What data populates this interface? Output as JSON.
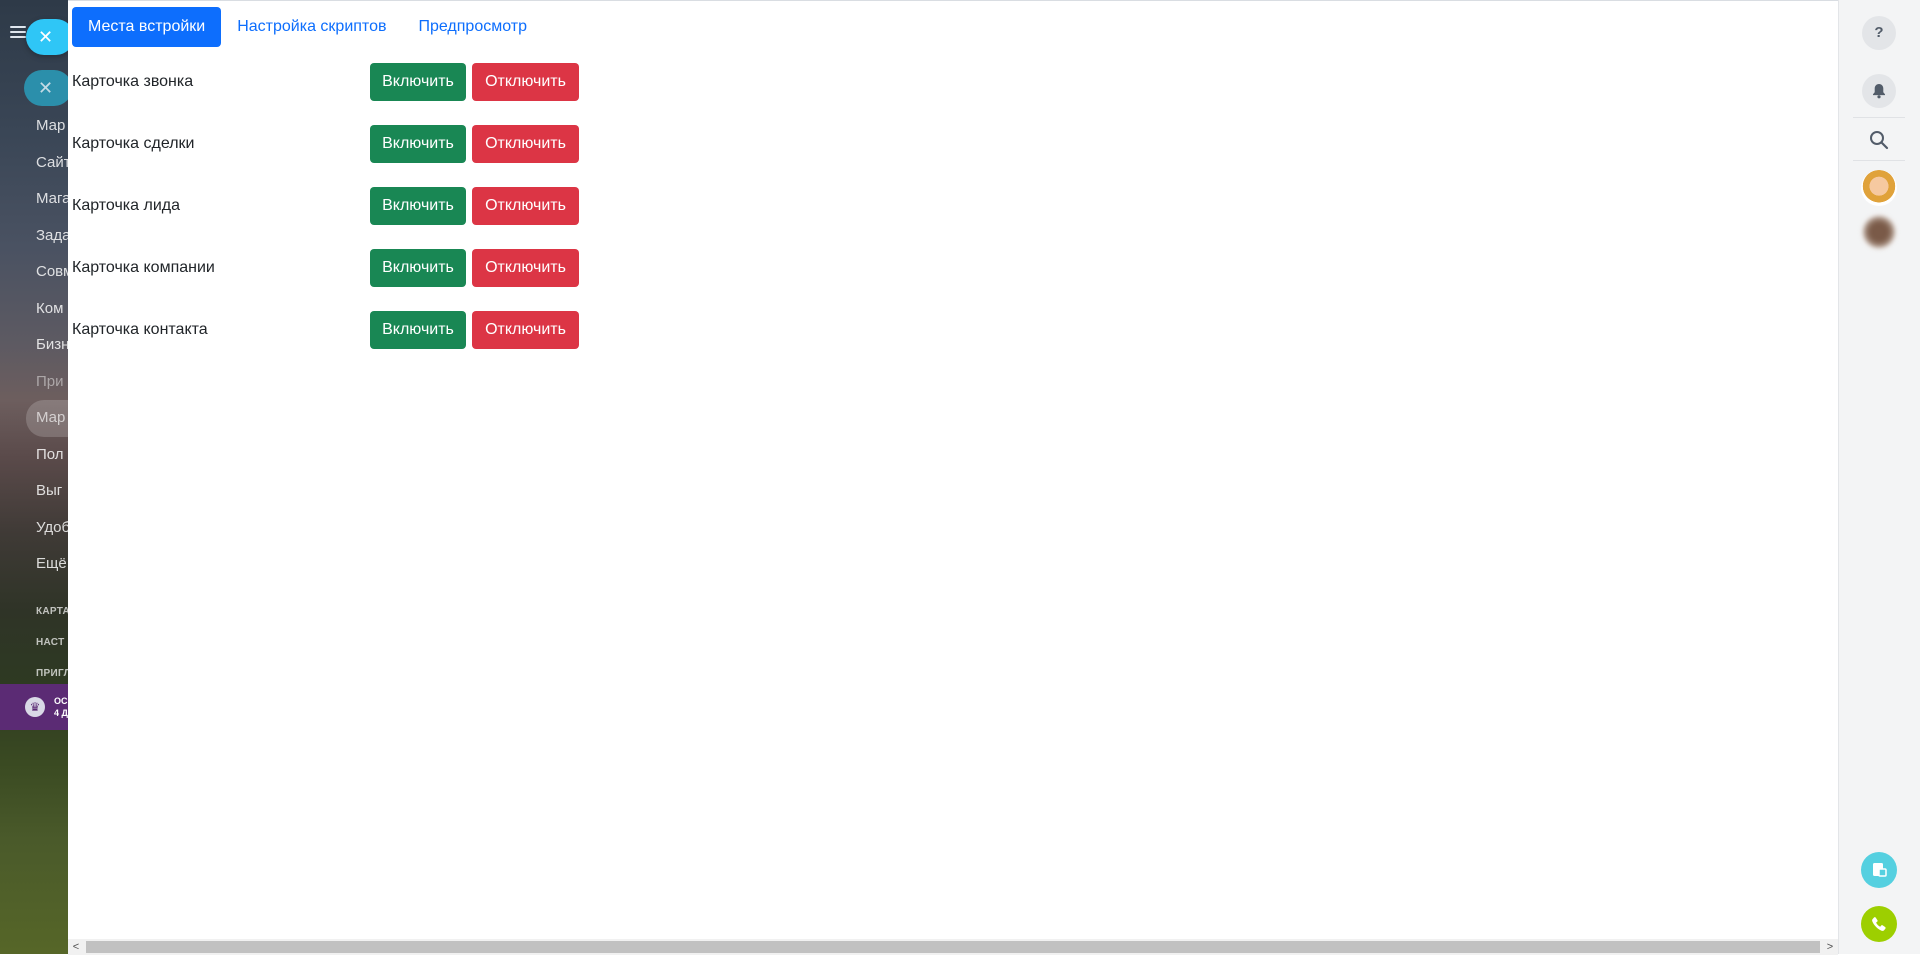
{
  "tabs": [
    {
      "label": "Места встройки",
      "active": true
    },
    {
      "label": "Настройка скриптов",
      "active": false
    },
    {
      "label": "Предпросмотр",
      "active": false
    }
  ],
  "placements": [
    {
      "label": "Карточка звонка"
    },
    {
      "label": "Карточка сделки"
    },
    {
      "label": "Карточка лида"
    },
    {
      "label": "Карточка компании"
    },
    {
      "label": "Карточка контакта"
    }
  ],
  "buttons": {
    "enable": "Включить",
    "disable": "Отключить"
  },
  "sidebar": {
    "items": [
      "Мар",
      "Сайт",
      "Мага",
      "Зада",
      "Совм",
      "Ком",
      "Бизн",
      "При",
      "Мар",
      "Пол",
      "Выг",
      "Удоб",
      "Ещё"
    ],
    "footer_links": [
      "КАРТА",
      "НАСТ",
      "ПРИГЛ"
    ],
    "promo": {
      "line1": "ОС",
      "line2": "4 Д"
    }
  },
  "right_bar": {
    "icons": [
      "help-icon",
      "bell-icon",
      "search-icon",
      "document-icon",
      "phone-icon"
    ]
  },
  "colors": {
    "primary": "#0d6efd",
    "success": "#198754",
    "danger": "#dc3545",
    "sidebar_accent": "#2fc6f6",
    "phone_fab": "#9dcf00"
  }
}
